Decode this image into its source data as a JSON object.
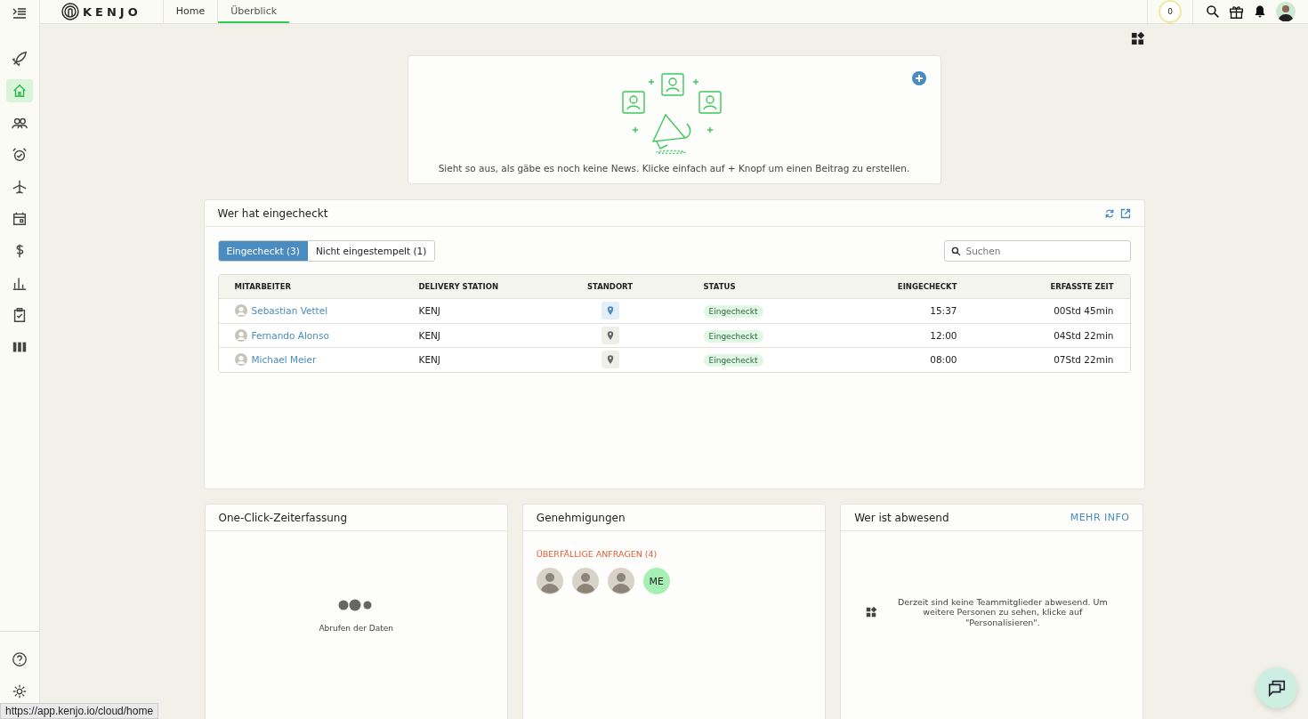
{
  "header": {
    "logo": "KENJO",
    "tabs": [
      {
        "label": "Home",
        "selected": false
      },
      {
        "label": "Überblick",
        "selected": true
      }
    ],
    "counter": "0"
  },
  "sidebar": {
    "items": [
      {
        "selected": false
      },
      {
        "selected": true
      },
      {
        "selected": false
      },
      {
        "selected": false
      },
      {
        "selected": false
      },
      {
        "selected": false
      },
      {
        "selected": false
      },
      {
        "selected": false
      },
      {
        "selected": false
      },
      {
        "selected": false
      }
    ]
  },
  "news": {
    "message": "Sieht so aus, als gäbe es noch keine News. Klicke einfach auf + Knopf um einen Beitrag zu erstellen."
  },
  "checked_in": {
    "title": "Wer hat eingecheckt",
    "tabs": [
      {
        "label": "Eingecheckt (3)",
        "selected": true
      },
      {
        "label": "Nicht eingestempelt (1)",
        "selected": false
      }
    ],
    "search": {
      "placeholder": "Suchen"
    },
    "columns": [
      "MITARBEITER",
      "DELIVERY STATION",
      "STANDORT",
      "STATUS",
      "EINGECHECKT",
      "ERFASSTE ZEIT"
    ],
    "rows": [
      {
        "name": "Sebastian Vettel",
        "station": "KENJ",
        "pin_active": true,
        "status": "Eingecheckt",
        "checked_in": "15:37",
        "time": "00Std 45min"
      },
      {
        "name": "Fernando Alonso",
        "station": "KENJ",
        "pin_active": false,
        "status": "Eingecheckt",
        "checked_in": "12:00",
        "time": "04Std 22min"
      },
      {
        "name": "Michael Meier",
        "station": "KENJ",
        "pin_active": false,
        "status": "Eingecheckt",
        "checked_in": "08:00",
        "time": "07Std 22min"
      }
    ]
  },
  "one_click": {
    "title": "One-Click-Zeiterfassung",
    "loading": "Abrufen der Daten"
  },
  "approvals": {
    "title": "Genehmigungen",
    "overdue": "ÜBERFÄLLIGE ANFRAGEN (4)",
    "avatars": [
      {
        "kind": "photo"
      },
      {
        "kind": "photo"
      },
      {
        "kind": "photo"
      },
      {
        "kind": "initials",
        "initials": "ME"
      }
    ]
  },
  "absent": {
    "title": "Wer ist abwesend",
    "link": "MEHR INFO",
    "message": "Derzeit sind keine Teammitglieder abwesend. Um weitere Personen zu sehen, klicke auf \"Personalisieren\"."
  },
  "status_url": "https://app.kenjo.io/cloud/home"
}
